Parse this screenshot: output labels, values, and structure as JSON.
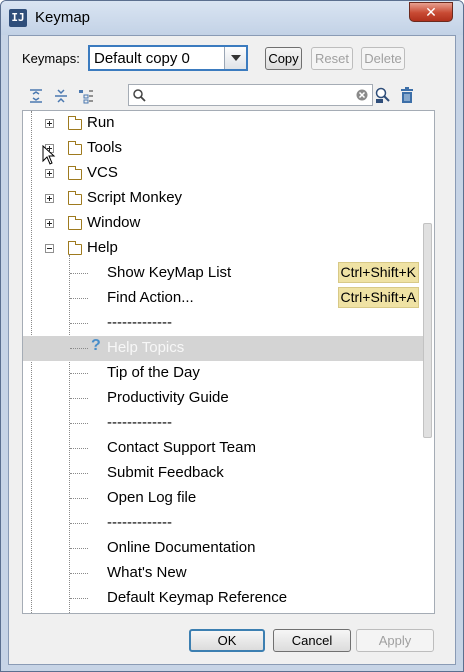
{
  "window": {
    "title": "Keymap",
    "close_glyph": "✕"
  },
  "keymaps": {
    "label": "Keymaps:",
    "selected": "Default copy 0"
  },
  "buttons": {
    "copy": "Copy",
    "reset": "Reset",
    "delete": "Delete",
    "ok": "OK",
    "cancel": "Cancel",
    "apply": "Apply"
  },
  "search": {
    "value": ""
  },
  "tree": {
    "folders": [
      {
        "label": "Run",
        "expanded": false
      },
      {
        "label": "Tools",
        "expanded": false
      },
      {
        "label": "VCS",
        "expanded": false
      },
      {
        "label": "Script Monkey",
        "expanded": false
      },
      {
        "label": "Window",
        "expanded": false
      },
      {
        "label": "Help",
        "expanded": true
      }
    ],
    "help_items": [
      {
        "label": "Show KeyMap List",
        "shortcut": "Ctrl+Shift+K"
      },
      {
        "label": "Find Action...",
        "shortcut": "Ctrl+Shift+A"
      },
      {
        "label": "-------------",
        "shortcut": ""
      },
      {
        "label": "Help Topics",
        "shortcut": "",
        "selected": true,
        "icon": "question-icon"
      },
      {
        "label": "Tip of the Day",
        "shortcut": ""
      },
      {
        "label": "Productivity Guide",
        "shortcut": ""
      },
      {
        "label": "-------------",
        "shortcut": ""
      },
      {
        "label": "Contact Support Team",
        "shortcut": ""
      },
      {
        "label": "Submit Feedback",
        "shortcut": ""
      },
      {
        "label": "Open Log file",
        "shortcut": ""
      },
      {
        "label": "-------------",
        "shortcut": ""
      },
      {
        "label": "Online Documentation",
        "shortcut": ""
      },
      {
        "label": "What's New",
        "shortcut": ""
      },
      {
        "label": "Default Keymap Reference",
        "shortcut": ""
      }
    ]
  }
}
